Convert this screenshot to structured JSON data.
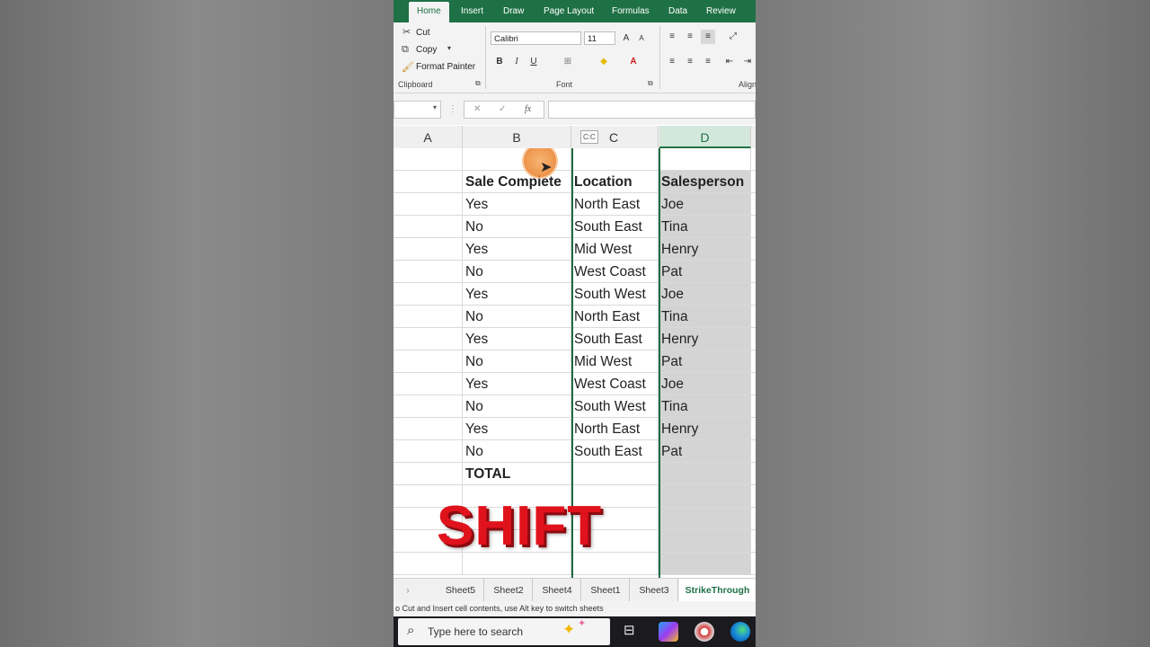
{
  "ribbon": {
    "tabs": [
      "Home",
      "Insert",
      "Draw",
      "Page Layout",
      "Formulas",
      "Data",
      "Review"
    ],
    "clipboard": {
      "cut": "Cut",
      "copy": "Copy",
      "format_painter": "Format Painter",
      "label": "Clipboard"
    },
    "font": {
      "name": "Calibri",
      "size": "11",
      "label": "Font",
      "bold": "B",
      "italic": "I",
      "underline": "U"
    },
    "alignment_label": "Align"
  },
  "formula_bar": {
    "fx": "fx"
  },
  "columns": [
    "A",
    "B",
    "C",
    "D"
  ],
  "copy_marker": "C:C",
  "table": {
    "headers": [
      "Sale Complete",
      "Location",
      "Salesperson"
    ],
    "rows": [
      [
        "Yes",
        "North East",
        "Joe"
      ],
      [
        "No",
        "South East",
        "Tina"
      ],
      [
        "Yes",
        "Mid West",
        "Henry"
      ],
      [
        "No",
        "West Coast",
        "Pat"
      ],
      [
        "Yes",
        "South West",
        "Joe"
      ],
      [
        "No",
        "North East",
        "Tina"
      ],
      [
        "Yes",
        "South East",
        "Henry"
      ],
      [
        "No",
        "Mid West",
        "Pat"
      ],
      [
        "Yes",
        "West Coast",
        "Joe"
      ],
      [
        "No",
        "South West",
        "Tina"
      ],
      [
        "Yes",
        "North East",
        "Henry"
      ],
      [
        "No",
        "South East",
        "Pat"
      ]
    ],
    "total_label": "TOTAL"
  },
  "overlay_text": "SHIFT",
  "sheets": [
    "Sheet5",
    "Sheet2",
    "Sheet4",
    "Sheet1",
    "Sheet3",
    "StrikeThrough"
  ],
  "active_sheet": "StrikeThrough",
  "status_text": "o Cut and Insert cell contents, use Alt key to switch sheets",
  "taskbar": {
    "search_placeholder": "Type here to search"
  },
  "colors": {
    "excel_green": "#1e7145",
    "overlay_red": "#e0121c",
    "selected_fill": "#d4d4d4"
  }
}
